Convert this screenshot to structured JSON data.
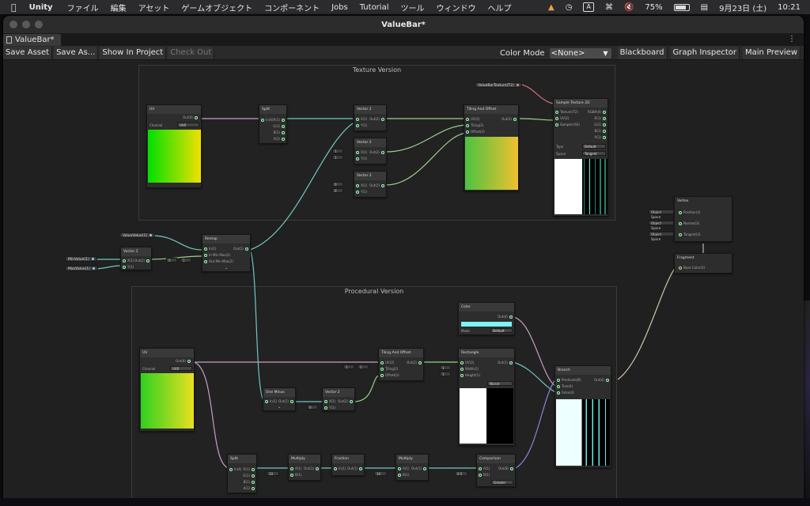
{
  "menubar": {
    "apple_icon": "apple-icon",
    "app_name": "Unity",
    "items": [
      "ファイル",
      "編集",
      "アセット",
      "ゲームオブジェクト",
      "コンポーネント",
      "Jobs",
      "Tutorial",
      "ツール",
      "ウィンドウ",
      "ヘルプ"
    ],
    "status": {
      "input_letter": "A",
      "battery": "75%",
      "date": "9月23日 (土)",
      "time": "10:21"
    }
  },
  "window": {
    "title": "ValueBar*",
    "tab_label": "ValueBar*",
    "toolbar": {
      "save_asset": "Save Asset",
      "save_as": "Save As...",
      "show_in_project": "Show In Project",
      "check_out": "Check Out",
      "color_mode_label": "Color Mode",
      "color_mode_value": "<None>",
      "blackboard": "Blackboard",
      "graph_inspector": "Graph Inspector",
      "main_preview": "Main Preview"
    }
  },
  "graph": {
    "groups": {
      "texture": "Texture Version",
      "procedural": "Procedural Version"
    },
    "properties": {
      "value_bar_texture": "ValueBarTexture(T2)",
      "value": "ValueValue(1)",
      "min_value": "MinValue(1)",
      "max_value": "MaxValue(1)"
    },
    "nodes": {
      "uv1": {
        "title": "UV",
        "out": "Out(4)",
        "channel_label": "Channel",
        "channel_value": "UV0"
      },
      "split1": {
        "title": "Split",
        "in": "In(4)",
        "outs": [
          "R(1)",
          "G(1)",
          "B(1)",
          "A(1)"
        ]
      },
      "vec2a": {
        "title": "Vector 2",
        "ins": [
          "X(1)",
          "Y(1)"
        ],
        "out": "Out(2)"
      },
      "vec2b": {
        "title": "Vector 2",
        "ins": [
          "X(1)",
          "Y(1)"
        ],
        "out": "Out(2)",
        "x": "1",
        "y": "1"
      },
      "vec2c": {
        "title": "Vector 2",
        "ins": [
          "X(1)",
          "Y(1)"
        ],
        "out": "Out(2)",
        "x": "0",
        "y": "0"
      },
      "tiling1": {
        "title": "Tiling And Offset",
        "ins": [
          "UV(2)",
          "Tiling(2)",
          "Offset(2)"
        ],
        "out": "Out(2)"
      },
      "sample": {
        "title": "Sample Texture 2D",
        "ins": [
          "Texture(T2)",
          "UV(2)",
          "Sampler(SS)"
        ],
        "outs": [
          "RGBA(4)",
          "R(1)",
          "G(1)",
          "B(1)",
          "A(1)"
        ],
        "type_label": "Type",
        "type_value": "Default",
        "space_label": "Space",
        "space_value": "Tangent"
      },
      "vec2d": {
        "title": "Vector 2",
        "ins": [
          "X(1)",
          "Y(1)"
        ],
        "out": "Out(2)"
      },
      "remap": {
        "title": "Remap",
        "ins": [
          "In(1)",
          "In Min Max(2)",
          "Out Min Max(2)"
        ],
        "out": "Out(1)",
        "f0": "0",
        "f1": "1"
      },
      "vertex": {
        "title": "Vertex",
        "rows": [
          {
            "space": "Object Space",
            "port": "Position(3)"
          },
          {
            "space": "Object Space",
            "port": "Normal(3)"
          },
          {
            "space": "Object Space",
            "port": "Tangent(3)"
          }
        ]
      },
      "fragment": {
        "title": "Fragment",
        "port": "Base Color(3)"
      },
      "color": {
        "title": "Color",
        "out": "Out(4)",
        "mode_label": "Mode",
        "mode_value": "Default"
      },
      "uv2": {
        "title": "UV",
        "out": "Out(4)",
        "channel_label": "Channel",
        "channel_value": "UV0"
      },
      "tiling2": {
        "title": "Tiling And Offset",
        "ins": [
          "UV(2)",
          "Tiling(2)",
          "Offset(2)"
        ],
        "out": "Out(2)",
        "x": "1",
        "y": "1"
      },
      "rect": {
        "title": "Rectangle",
        "ins": [
          "UV(2)",
          "Width(1)",
          "Height(1)"
        ],
        "out": "Out(1)",
        "w": "1",
        "h": "1",
        "mode": "Nicest"
      },
      "oneminus": {
        "title": "One Minus",
        "in": "In(1)",
        "out": "Out(1)"
      },
      "vec2e": {
        "title": "Vector 2",
        "ins": [
          "X(1)",
          "Y(1)"
        ],
        "out": "Out(2)",
        "y": "0"
      },
      "branch": {
        "title": "Branch",
        "ins": [
          "Predicate(B)",
          "True(4)",
          "False(4)"
        ],
        "out": "Out(4)"
      },
      "split2": {
        "title": "Split",
        "in": "In(4)",
        "outs": [
          "R(1)",
          "G(1)",
          "B(1)",
          "A(1)"
        ]
      },
      "mul1": {
        "title": "Multiply",
        "ins": [
          "A(1)",
          "B(1)"
        ],
        "out": "Out(1)",
        "b": "10"
      },
      "fraction": {
        "title": "Fraction",
        "in": "In(1)",
        "out": "Out(1)"
      },
      "mul2": {
        "title": "Multiply",
        "ins": [
          "A(1)",
          "B(1)"
        ],
        "out": "Out(1)",
        "b": "10"
      },
      "comparison": {
        "title": "Comparison",
        "ins": [
          "A(1)",
          "B(1)"
        ],
        "out": "Out(B)",
        "b": "0.5",
        "mode": "Greater"
      }
    }
  },
  "colors": {
    "wire_green": "#9cd08a",
    "wire_teal": "#6fc8c0",
    "wire_pink": "#c79fc2",
    "wire_purple": "#8b86d6",
    "wire_gray": "#c8c8a8",
    "wire_red": "#d0707a"
  }
}
